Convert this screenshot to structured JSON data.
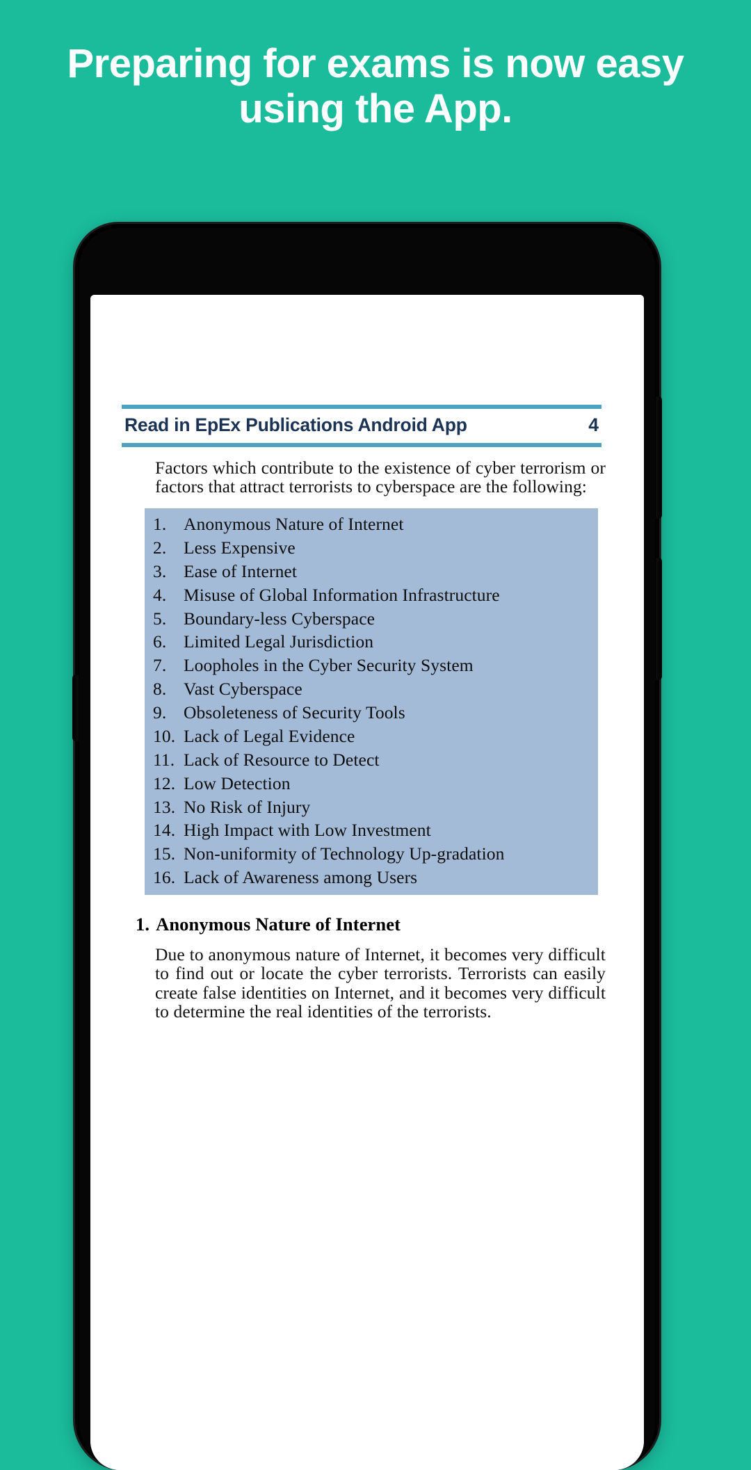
{
  "promo": {
    "headline": "Preparing for exams is now easy using the App.",
    "background_color": "#1abc9c",
    "text_color": "#ffffff"
  },
  "device": {
    "frame_color": "#000000",
    "screen_color": "#ffffff",
    "buttons": [
      "volume-up",
      "volume-down",
      "power"
    ]
  },
  "document": {
    "header": {
      "title": "Read in EpEx Publications Android App",
      "page_number": "4",
      "rule_color": "#4ba3c3",
      "text_color": "#1b3355"
    },
    "intro_paragraph": "Factors which contribute to the existence of cyber terrorism or factors that attract terrorists to cyberspace are the following:",
    "highlight_color": "#a4bbd8",
    "factor_list": [
      {
        "num": "1.",
        "text": "Anonymous Nature of Internet"
      },
      {
        "num": "2.",
        "text": "Less Expensive"
      },
      {
        "num": "3.",
        "text": "Ease of Internet"
      },
      {
        "num": "4.",
        "text": "Misuse of Global Information Infrastructure"
      },
      {
        "num": "5.",
        "text": "Boundary-less Cyberspace"
      },
      {
        "num": "6.",
        "text": "Limited Legal Jurisdiction"
      },
      {
        "num": "7.",
        "text": "Loopholes in the Cyber Security System"
      },
      {
        "num": "8.",
        "text": "Vast Cyberspace"
      },
      {
        "num": "9.",
        "text": " Obsoleteness of Security Tools"
      },
      {
        "num": "10.",
        "text": "Lack of Legal Evidence"
      },
      {
        "num": "11.",
        "text": "Lack of Resource to Detect"
      },
      {
        "num": "12.",
        "text": "Low Detection"
      },
      {
        "num": "13.",
        "text": "No Risk of Injury"
      },
      {
        "num": "14.",
        "text": "High Impact with Low Investment"
      },
      {
        "num": "15.",
        "text": "Non-uniformity of Technology Up-gradation"
      },
      {
        "num": "16.",
        "text": "Lack of Awareness among Users"
      }
    ],
    "section": {
      "number": "1.",
      "heading": "Anonymous Nature of Internet",
      "body": "Due to anonymous nature of Internet, it becomes very difficult to find out or locate the cyber terrorists. Terrorists can easily create false identities on Internet, and it becomes very difficult to determine the real identities of the terrorists."
    }
  }
}
